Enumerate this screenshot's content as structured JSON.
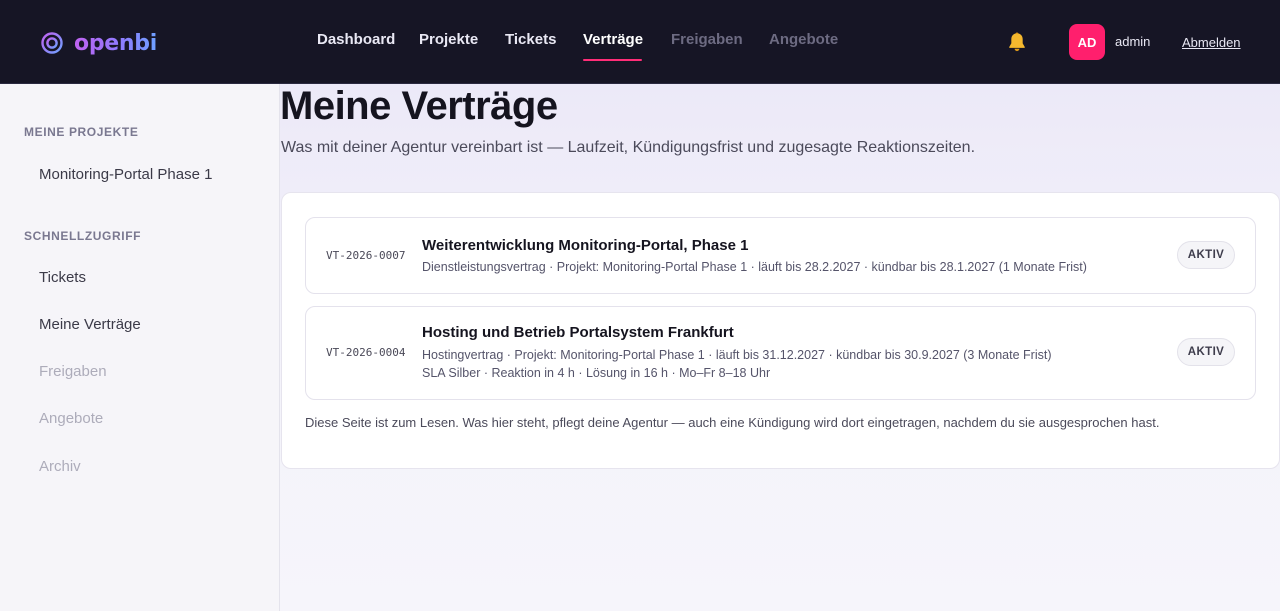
{
  "brand": {
    "name": "openbi"
  },
  "nav": {
    "items": [
      {
        "label": "Dashboard",
        "state": "normal"
      },
      {
        "label": "Projekte",
        "state": "normal"
      },
      {
        "label": "Tickets",
        "state": "normal"
      },
      {
        "label": "Verträge",
        "state": "active"
      },
      {
        "label": "Freigaben",
        "state": "dim"
      },
      {
        "label": "Angebote",
        "state": "dim"
      }
    ],
    "notifications_icon": "bell-icon",
    "user": {
      "initials": "AD",
      "name": "admin"
    },
    "logout_label": "Abmelden"
  },
  "sidebar": {
    "projects_heading": "MEINE PROJEKTE",
    "projects": [
      {
        "label": "Monitoring-Portal Phase 1"
      }
    ],
    "quick_heading": "SCHNELLZUGRIFF",
    "quick": [
      {
        "label": "Tickets",
        "state": "normal"
      },
      {
        "label": "Meine Verträge",
        "state": "normal"
      },
      {
        "label": "Freigaben",
        "state": "dim"
      },
      {
        "label": "Angebote",
        "state": "dim"
      },
      {
        "label": "Archiv",
        "state": "dim"
      }
    ]
  },
  "main": {
    "title": "Meine Verträge",
    "subtitle": "Was mit deiner Agentur vereinbart ist — Laufzeit, Kündigungsfrist und zugesagte Reaktionszeiten.",
    "contracts": [
      {
        "id": "VT-2026-0007",
        "title": "Weiterentwicklung Monitoring-Portal, Phase 1",
        "meta": "Dienstleistungsvertrag · Projekt: Monitoring-Portal Phase 1 · läuft bis 28.2.2027 · kündbar bis 28.1.2027 (1 Monate Frist)",
        "status": "AKTIV"
      },
      {
        "id": "VT-2026-0004",
        "title": "Hosting und Betrieb Portalsystem Frankfurt",
        "meta": "Hostingvertrag · Projekt: Monitoring-Portal Phase 1 · läuft bis 31.12.2027 · kündbar bis 30.9.2027 (3 Monate Frist)",
        "sla": "SLA Silber · Reaktion in 4 h · Lösung in 16 h · Mo–Fr 8–18 Uhr",
        "status": "AKTIV"
      }
    ],
    "footnote": "Diese Seite ist zum Lesen. Was hier steht, pflegt deine Agentur — auch eine Kündigung wird dort eingetragen, nachdem du sie ausgesprochen hast."
  },
  "colors": {
    "topbar_bg": "#161525",
    "accent": "#ff2d78",
    "avatar_bg": "#ff1f6d",
    "bell": "#f5b82e",
    "logo_gradient_start": "#c062f0",
    "logo_gradient_end": "#6ea1ff"
  }
}
